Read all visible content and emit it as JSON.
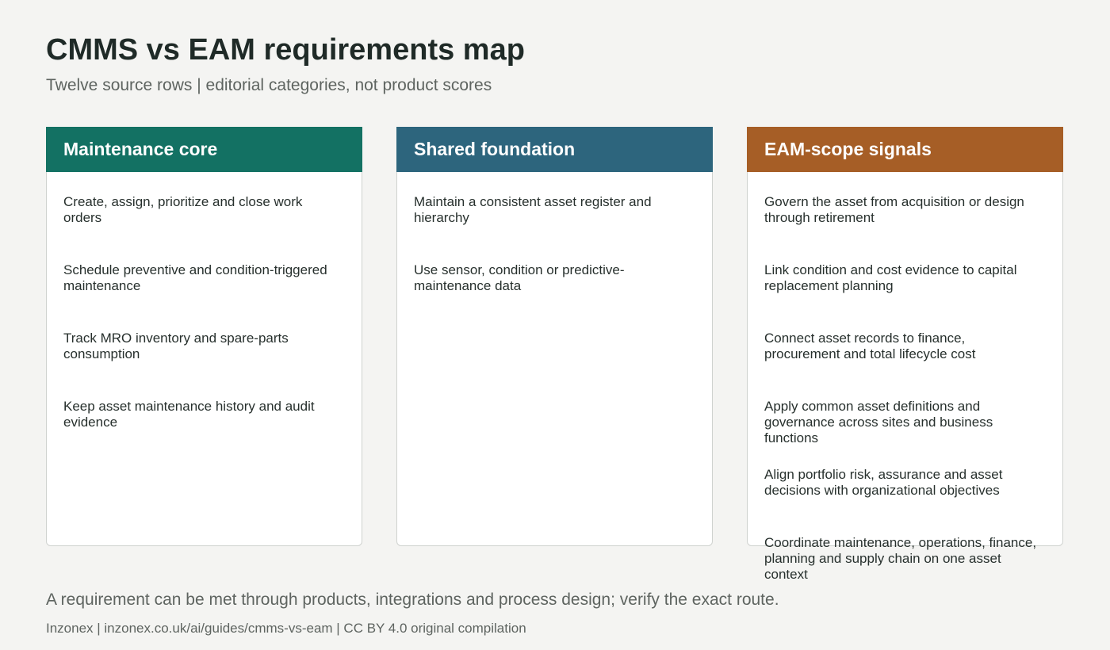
{
  "title": "CMMS vs EAM requirements map",
  "subtitle": "Twelve source rows | editorial categories, not product scores",
  "columns": [
    {
      "heading": "Maintenance core",
      "color": "#137163",
      "items": [
        "Create, assign, prioritize and close work orders",
        "Schedule preventive and condition-triggered maintenance",
        "Track MRO inventory and spare-parts consumption",
        "Keep asset maintenance history and audit evidence"
      ]
    },
    {
      "heading": "Shared foundation",
      "color": "#2d657d",
      "items": [
        "Maintain a consistent asset register and hierarchy",
        "Use sensor, condition or predictive-maintenance data"
      ]
    },
    {
      "heading": "EAM-scope signals",
      "color": "#a65e26",
      "items": [
        "Govern the asset from acquisition or design through retirement",
        "Link condition and cost evidence to capital replacement planning",
        "Connect asset records to finance, procurement and total lifecycle cost",
        "Apply common asset definitions and governance across sites and business functions",
        "Align portfolio risk, assurance and asset decisions with organizational objectives",
        "Coordinate maintenance, operations, finance, planning and supply chain on one asset context"
      ]
    }
  ],
  "footer_note": "A requirement can be met through products, integrations and process design; verify the exact route.",
  "credits": "Inzonex | inzonex.co.uk/ai/guides/cmms-vs-eam | CC BY 4.0 original compilation"
}
